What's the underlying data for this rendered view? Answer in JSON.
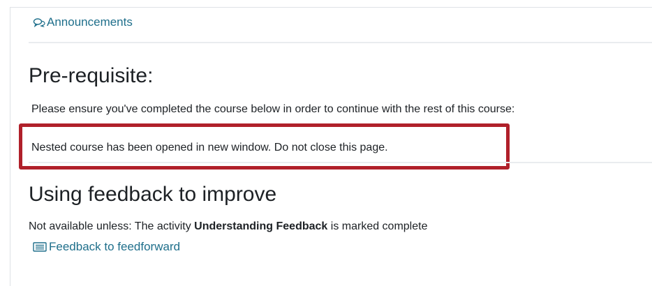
{
  "announcements": {
    "icon": "forum-icon",
    "label": "Announcements"
  },
  "prerequisite": {
    "title": "Pre-requisite:",
    "instruction": "Please ensure you've completed the course below in order to continue with the rest of this course:",
    "nested_notice": "Nested course has been opened in new window. Do not close this page."
  },
  "feedback_section": {
    "title": "Using feedback to improve",
    "restriction_prefix": "Not available unless: The activity ",
    "restriction_activity": "Understanding Feedback",
    "restriction_suffix": " is marked complete",
    "link_icon": "page-icon",
    "link_label": "Feedback to feedforward"
  },
  "colors": {
    "link": "#1f6f8b",
    "highlight_border": "#b0202a",
    "text": "#1d2125"
  }
}
